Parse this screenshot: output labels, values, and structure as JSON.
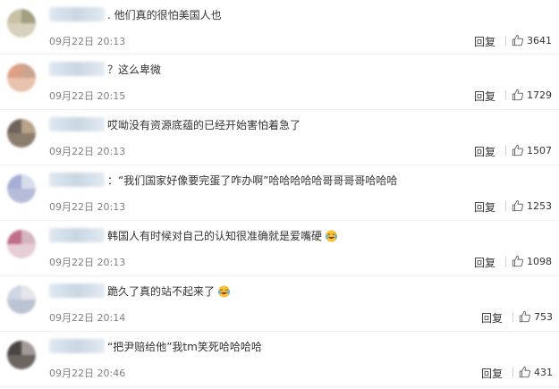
{
  "comments": [
    {
      "text": ". 他们真的很怕美国人也",
      "time": "09月22日 20:13",
      "reply": "回复",
      "likes": "3641",
      "emoji": false,
      "avatar_colors": [
        "#c9c0a6",
        "#a39e80",
        "#d6d0bd"
      ]
    },
    {
      "text": "？这么卑微",
      "time": "09月22日 20:15",
      "reply": "回复",
      "likes": "1729",
      "emoji": false,
      "avatar_colors": [
        "#e0a085",
        "#caa48f",
        "#e9c2ad"
      ]
    },
    {
      "text": "哎呦没有资源底蕴的已经开始害怕着急了",
      "time": "09月22日 20:13",
      "reply": "回复",
      "likes": "1507",
      "emoji": false,
      "avatar_colors": [
        "#6f645c",
        "#b9a38a",
        "#8c7d6e"
      ]
    },
    {
      "text": "：“我们国家好像要完蛋了咋办啊”哈哈哈哈哈哥哥哥哥哈哈哈",
      "time": "09月22日 20:13",
      "reply": "回复",
      "likes": "1253",
      "emoji": false,
      "avatar_colors": [
        "#a6aed8",
        "#d8dcec",
        "#b7bdd9"
      ]
    },
    {
      "text": "韩国人有时候对自己的认知很准确就是爱嘴硬",
      "time": "09月22日 20:13",
      "reply": "回复",
      "likes": "1098",
      "emoji": true,
      "avatar_colors": [
        "#c06e8a",
        "#d4b6c1",
        "#e6cdd6"
      ]
    },
    {
      "text": "跪久了真的站不起来了",
      "time": "09月22日 20:14",
      "reply": "回复",
      "likes": "753",
      "emoji": true,
      "avatar_colors": [
        "#cfd7e6",
        "#e6e6ea",
        "#bcc4d4"
      ]
    },
    {
      "text": "“把尹赔给他”我tm笑死哈哈哈哈",
      "time": "09月22日 20:46",
      "reply": "回复",
      "likes": "431",
      "emoji": false,
      "avatar_colors": [
        "#4a4542",
        "#a49a97",
        "#6c6460"
      ]
    }
  ]
}
